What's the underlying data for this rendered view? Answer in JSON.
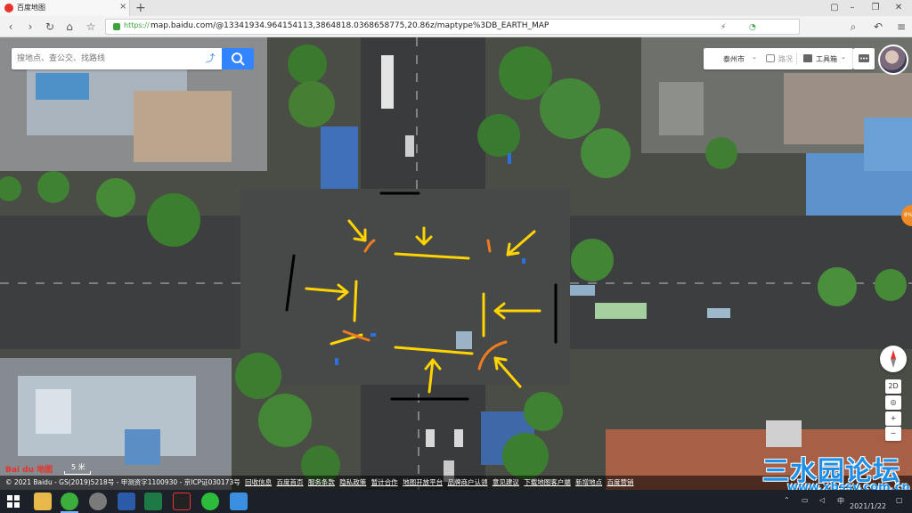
{
  "browser": {
    "tab_title": "百度地图",
    "tab_close": "×",
    "tab_new": "+",
    "url_protocol": "https://",
    "url": "map.baidu.com/@13341934.964154113,3864818.0368658775,20.86z/maptype%3DB_EARTH_MAP"
  },
  "search": {
    "placeholder": "搜地点、查公交、找路线"
  },
  "topbar": {
    "city": "泰州市",
    "weather_text": "路况",
    "toolbox": "工具箱"
  },
  "side_badge": "8%",
  "map_controls": {
    "mode_2d": "2D",
    "zoom_in": "+",
    "zoom_out": "−"
  },
  "scale": {
    "logo": "Bai du 地图",
    "label": "5 米"
  },
  "footer": {
    "copyright": "© 2021 Baidu - GS(2019)5218号 - 甲测资字1100930 - 京ICP证030173号",
    "links": [
      "回收信息",
      "百度首页",
      "服务条款",
      "隐私政策",
      "暂计合作",
      "地图开放平台",
      "品牌商户认领",
      "意见建议",
      "下载地图客户端",
      "新增地点",
      "百度营销"
    ]
  },
  "watermark": {
    "brand": "三水园论坛",
    "url": "www.xbssy.com.cn"
  },
  "taskbar": {
    "date": "2021/1/22"
  },
  "colors": {
    "arrow": "#ffd400",
    "stopline_black": "#000000",
    "curb_orange": "#f07a20",
    "baidu_blue": "#3385ff"
  }
}
